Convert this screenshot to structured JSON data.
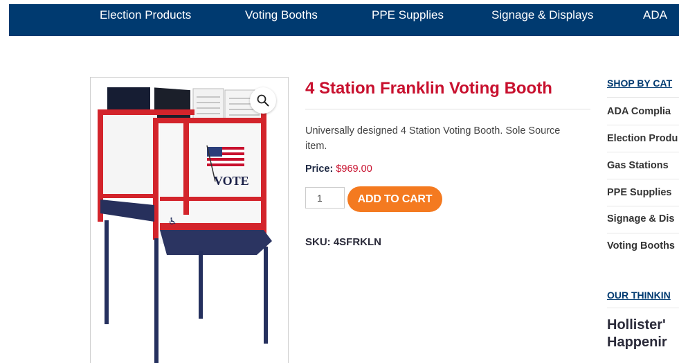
{
  "nav": {
    "items": [
      {
        "label": "Election Products"
      },
      {
        "label": "Voting Booths"
      },
      {
        "label": "PPE Supplies"
      },
      {
        "label": "Signage & Displays"
      },
      {
        "label": "ADA C"
      }
    ]
  },
  "product": {
    "title": "4 Station Franklin Voting Booth",
    "description": "Universally designed 4 Station Voting Booth. Sole Source item.",
    "price_label": "Price:",
    "price_value": "$969.00",
    "quantity": "1",
    "add_to_cart_label": "ADD TO CART",
    "sku": "SKU: 4SFRKLN",
    "image_vote_text": "VOTE"
  },
  "sidebar": {
    "shop_heading": "SHOP BY CAT",
    "categories": [
      {
        "label": "ADA Complia"
      },
      {
        "label": "Election Produ"
      },
      {
        "label": "Gas Stations"
      },
      {
        "label": "PPE Supplies"
      },
      {
        "label": "Signage & Dis"
      },
      {
        "label": "Voting Booths"
      }
    ],
    "thinking_heading": "OUR THINKIN",
    "post_title_line1": "Hollister'",
    "post_title_line2": "Happenir"
  },
  "colors": {
    "nav_bg": "#003a70",
    "title_red": "#c8102e",
    "cart_orange": "#f47a20"
  }
}
